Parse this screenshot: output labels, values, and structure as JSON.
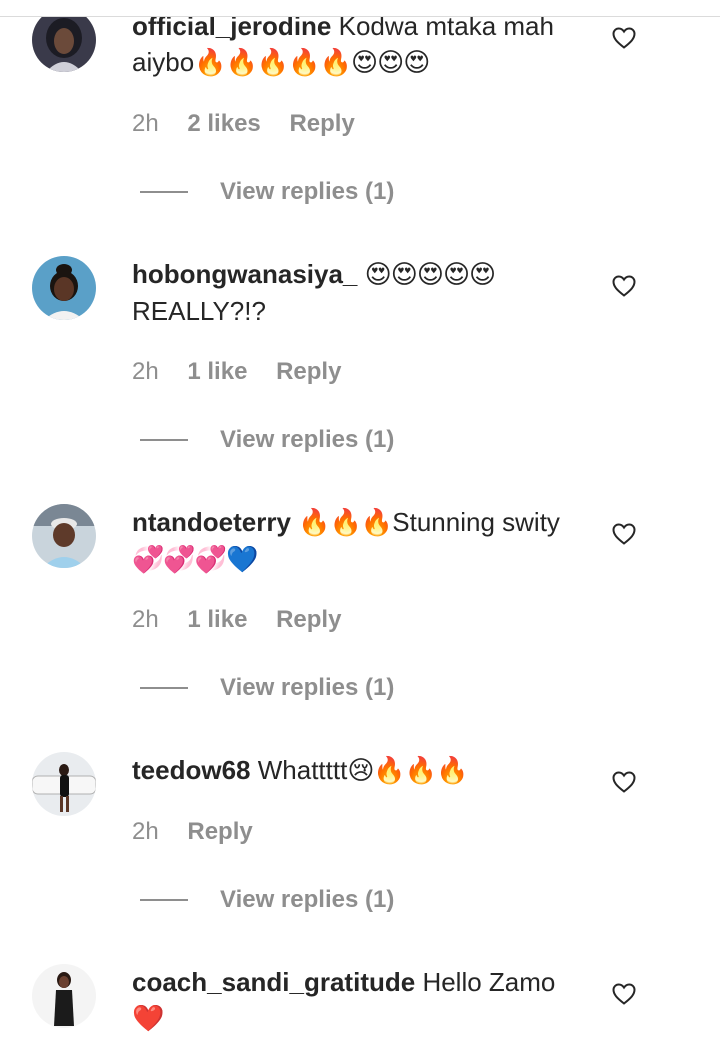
{
  "comments": [
    {
      "username": "official_jerodine",
      "text": "Kodwa mtaka mah aiybo",
      "emoji": "🔥🔥🔥🔥🔥😍😍😍",
      "time": "2h",
      "likes": "2 likes",
      "reply": "Reply",
      "view_replies": "View replies (1)"
    },
    {
      "username": "hobongwanasiya_",
      "text": "",
      "emoji": "😍😍😍😍😍",
      "text_after": "REALLY?!?",
      "time": "2h",
      "likes": "1 like",
      "reply": "Reply",
      "view_replies": "View replies (1)"
    },
    {
      "username": "ntandoeterry",
      "emoji": "🔥🔥🔥",
      "text": "Stunning swity",
      "emoji_after": "💞💞💞💙",
      "time": "2h",
      "likes": "1 like",
      "reply": "Reply",
      "view_replies": "View replies (1)"
    },
    {
      "username": "teedow68",
      "text": "Whattttt",
      "emoji": "😢🔥🔥🔥",
      "time": "2h",
      "reply": "Reply",
      "view_replies": "View replies (1)"
    },
    {
      "username": "coach_sandi_gratitude",
      "text": "Hello Zamo",
      "emoji": "❤️"
    }
  ],
  "icons": {
    "like": "heart-outline-icon"
  },
  "colors": {
    "text": "#262626",
    "meta": "#8e8e8e",
    "divider": "#dbdbdb"
  }
}
